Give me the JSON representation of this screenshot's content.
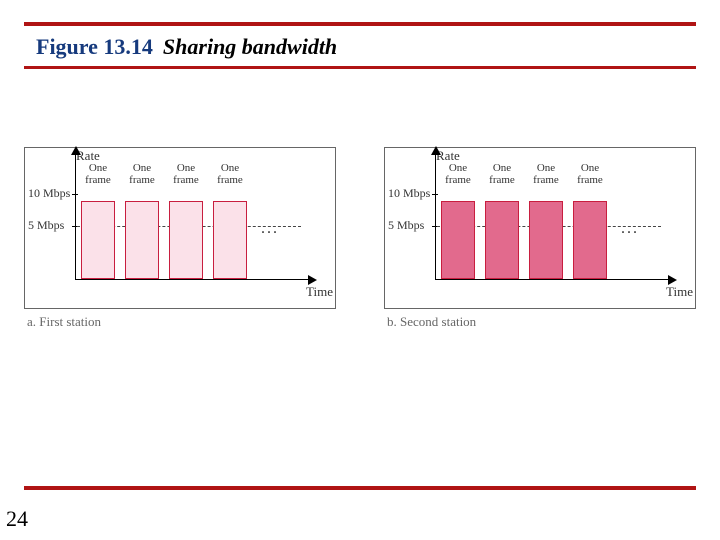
{
  "figure": {
    "number": "Figure 13.14",
    "caption": "Sharing bandwidth"
  },
  "axis": {
    "rate_label": "Rate",
    "time_label": "Time",
    "tick_10": "10 Mbps",
    "tick_5": "5 Mbps",
    "ellipsis": "..."
  },
  "bar": {
    "line1": "One",
    "line2": "frame"
  },
  "subcap": {
    "a": "a. First station",
    "b": "b. Second station"
  },
  "page_number": "24",
  "chart_data": [
    {
      "type": "bar",
      "title": "a. First station",
      "xlabel": "Time",
      "ylabel": "Rate",
      "ylim": [
        0,
        10
      ],
      "yticks": [
        5,
        10
      ],
      "ytick_labels": [
        "5 Mbps",
        "10 Mbps"
      ],
      "categories": [
        "One frame",
        "One frame",
        "One frame",
        "One frame"
      ],
      "values": [
        10,
        10,
        10,
        10
      ],
      "dashed_reference": 5,
      "continues": true
    },
    {
      "type": "bar",
      "title": "b. Second station",
      "xlabel": "Time",
      "ylabel": "Rate",
      "ylim": [
        0,
        10
      ],
      "yticks": [
        5,
        10
      ],
      "ytick_labels": [
        "5 Mbps",
        "10 Mbps"
      ],
      "categories": [
        "One frame",
        "One frame",
        "One frame",
        "One frame"
      ],
      "values": [
        10,
        10,
        10,
        10
      ],
      "dashed_reference": 5,
      "continues": true
    }
  ]
}
